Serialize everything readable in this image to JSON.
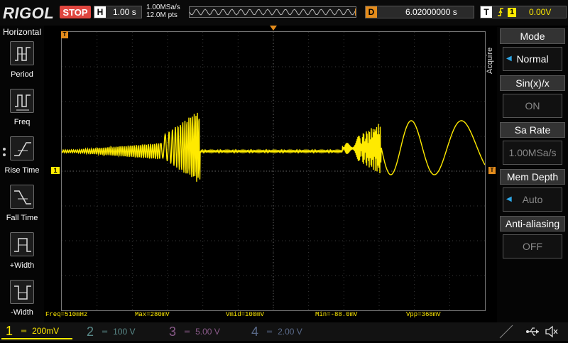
{
  "header": {
    "brand": "RIGOL",
    "run_state": "STOP",
    "horizontal_tag": "H",
    "timebase": "1.00 s",
    "sample_rate": "1.00MSa/s",
    "memory_points": "12.0M pts",
    "delay_tag": "D",
    "delay": "6.02000000 s",
    "trigger_tag": "T",
    "trigger_source": "1",
    "trigger_level": "0.00V"
  },
  "left_menu": {
    "title": "Horizontal",
    "items": [
      {
        "label": "Period",
        "icon": "period-icon"
      },
      {
        "label": "Freq",
        "icon": "frequency-icon"
      },
      {
        "label": "Rise Time",
        "icon": "rise-time-icon"
      },
      {
        "label": "Fall Time",
        "icon": "fall-time-icon"
      },
      {
        "label": "+Width",
        "icon": "positive-width-icon"
      },
      {
        "label": "-Width",
        "icon": "negative-width-icon"
      }
    ]
  },
  "measurements": {
    "freq": "Freq=510mHz",
    "max": "Max=280mV",
    "vmid": "Vmid=100mV",
    "min": "Min=-88.0mV",
    "vpp": "Vpp=368mV"
  },
  "right_menu": {
    "side_label": "Acquire",
    "items": [
      {
        "title": "Mode",
        "value": "Normal"
      },
      {
        "title": "Sin(x)/x",
        "value": "ON"
      },
      {
        "title": "Sa Rate",
        "value": "1.00MSa/s"
      },
      {
        "title": "Mem Depth",
        "value": "Auto"
      },
      {
        "title": "Anti-aliasing",
        "value": "OFF"
      }
    ]
  },
  "channels": [
    {
      "num": "1",
      "scale": "200mV",
      "color": "#ffea00"
    },
    {
      "num": "2",
      "scale": "100 V",
      "color": "#00c8c8"
    },
    {
      "num": "3",
      "scale": "5.00 V",
      "color": "#d040d0"
    },
    {
      "num": "4",
      "scale": "2.00 V",
      "color": "#2f7fe0"
    }
  ],
  "markers": {
    "trigger_left": "T",
    "channel_left": "1",
    "trigger_right": "T"
  },
  "colors": {
    "trace": "#ffea00",
    "stop": "#e0463f",
    "delay_accent": "#e48c1c"
  }
}
